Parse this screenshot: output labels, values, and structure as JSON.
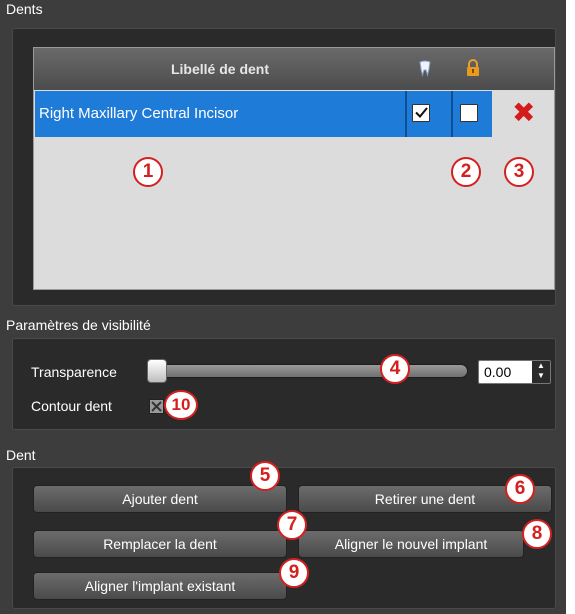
{
  "dents_group": {
    "title": "Dents",
    "table": {
      "header_label": "Libellé de dent",
      "header_icons": [
        "tooth-visibility-icon",
        "lock-icon"
      ],
      "rows": [
        {
          "label": "Right Maxillary Central Incisor",
          "visible": true,
          "locked": false
        }
      ]
    }
  },
  "visibility_group": {
    "title": "Paramètres de visibilité",
    "transparency_label": "Transparence",
    "transparency_value": "0.00",
    "transparency_fraction": 0.0,
    "contour_label": "Contour dent"
  },
  "dent_group": {
    "title": "Dent",
    "buttons": {
      "add": "Ajouter dent",
      "remove": "Retirer une dent",
      "replace": "Remplacer la dent",
      "align_new": "Aligner le nouvel implant",
      "align_existing": "Aligner l'implant existant"
    }
  },
  "callouts": [
    "1",
    "2",
    "3",
    "4",
    "5",
    "6",
    "7",
    "8",
    "9",
    "10"
  ],
  "colors": {
    "selection": "#1f7bd8",
    "callout_red": "#d42020",
    "delete_red": "#d41c1c",
    "background": "#3d3d3d"
  }
}
